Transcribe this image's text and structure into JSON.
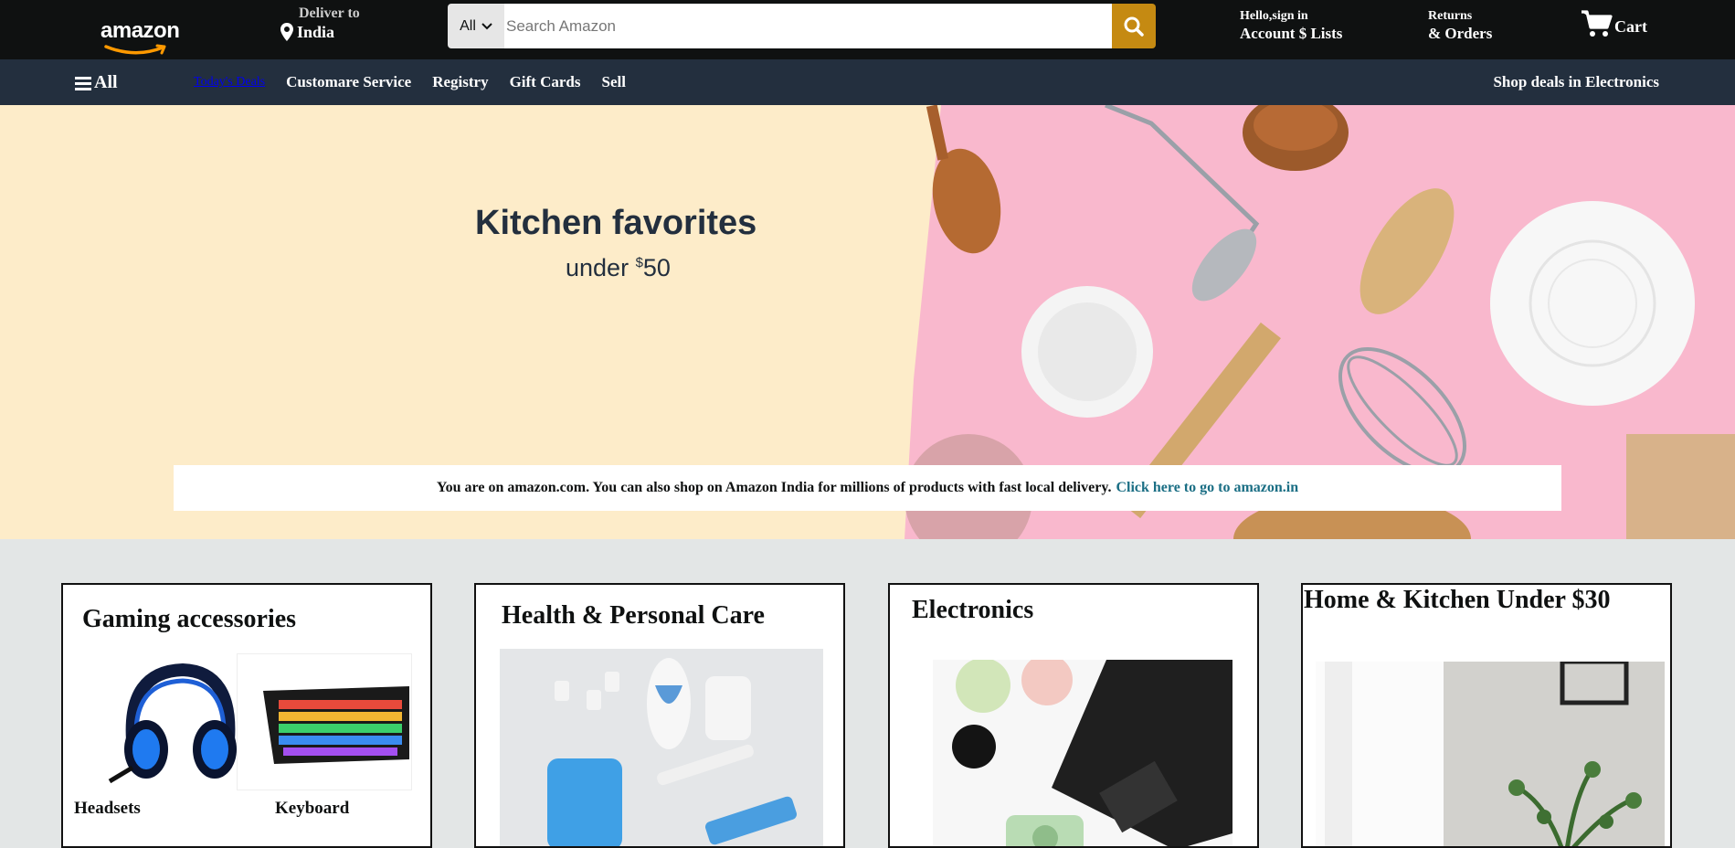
{
  "header": {
    "logo_text": "amazon",
    "deliver_to": "Deliver to",
    "location": "India",
    "search": {
      "category": "All",
      "placeholder": "Search Amazon",
      "value": ""
    },
    "account_line1": "Hello,sign in",
    "account_line2": "Account $ Lists",
    "returns_line1": "Returns",
    "returns_line2": "& Orders",
    "cart_label": "Cart"
  },
  "subnav": {
    "all_label": "All",
    "links": [
      "Today's Deals",
      "Customare Service",
      "Registry",
      "Gift Cards",
      "Sell"
    ],
    "promo": "Shop deals in Electronics"
  },
  "hero": {
    "title": "Kitchen favorites",
    "subtitle_prefix": "under ",
    "subtitle_currency": "$",
    "subtitle_amount": "50",
    "notice_text": "You are on amazon.com. You can also shop on Amazon India for millions of products with fast local delivery.",
    "notice_link": "Click here to go to amazon.in"
  },
  "cards": [
    {
      "title": "Gaming accessories",
      "items": [
        "Headsets",
        "Keyboard"
      ]
    },
    {
      "title": "Health & Personal Care"
    },
    {
      "title": "Electronics"
    },
    {
      "title": "Home & Kitchen Under $30"
    }
  ],
  "colors": {
    "nav_bg": "#0f1111",
    "subnav_bg": "#232f3e",
    "search_button": "#c58a12",
    "hero_cream": "#fdecc9",
    "hero_pink": "#f9b8cd",
    "page_bg": "#e3e6e6",
    "link_teal": "#1a6e84"
  },
  "icons": [
    "location-pin-icon",
    "chevron-down-icon",
    "search-icon",
    "cart-icon",
    "hamburger-icon",
    "amazon-smile-icon"
  ]
}
